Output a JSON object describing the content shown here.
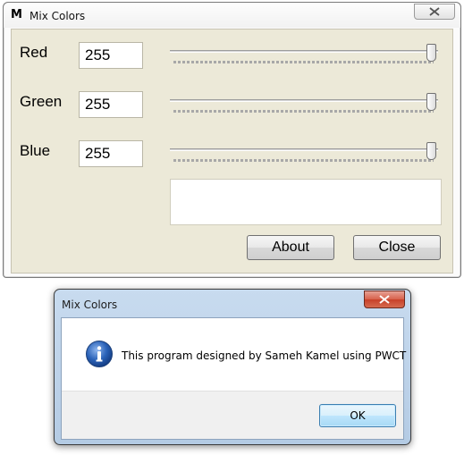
{
  "main_window": {
    "icon_letter": "M",
    "title": "Mix Colors",
    "faint_bg_title_1": "",
    "faint_bg_title_2": "",
    "rows": [
      {
        "label": "Red",
        "value": "255",
        "slider_fraction": 1.0
      },
      {
        "label": "Green",
        "value": "255",
        "slider_fraction": 1.0
      },
      {
        "label": "Blue",
        "value": "255",
        "slider_fraction": 1.0
      }
    ],
    "preview_color": "#ffffff",
    "about_label": "About",
    "close_label": "Close"
  },
  "message_box": {
    "title": "Mix Colors",
    "text": "This program designed by Sameh Kamel using PWCT",
    "ok_label": "OK",
    "icon": "info-icon"
  },
  "colors": {
    "client_bg": "#ece9d8",
    "close_red": "#c74029",
    "info_blue": "#2a62b8"
  }
}
